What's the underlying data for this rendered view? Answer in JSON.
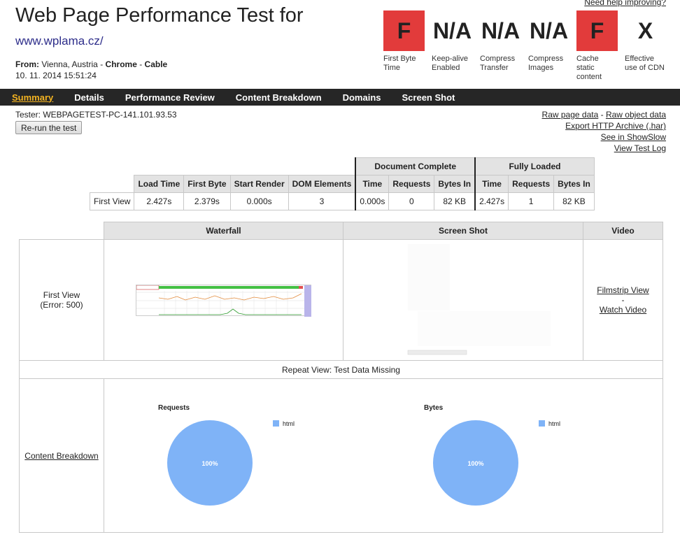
{
  "header": {
    "help_link": "Need help improving?",
    "title": "Web Page Performance Test for",
    "url": "www.wplama.cz/",
    "from_label": "From:",
    "from_location": "Vienna, Austria",
    "sep1": " - ",
    "browser": "Chrome",
    "sep2": " - ",
    "connection": "Cable",
    "date": "10. 11. 2014 15:51:24"
  },
  "grades": [
    {
      "value": "F",
      "label": "First Byte Time",
      "status": "fail"
    },
    {
      "value": "N/A",
      "label": "Keep-alive Enabled",
      "status": "na"
    },
    {
      "value": "N/A",
      "label": "Compress Transfer",
      "status": "na"
    },
    {
      "value": "N/A",
      "label": "Compress Images",
      "status": "na"
    },
    {
      "value": "F",
      "label": "Cache static content",
      "status": "fail"
    },
    {
      "value": "X",
      "label": "Effective use of CDN",
      "status": "na"
    }
  ],
  "nav": {
    "items": [
      "Summary",
      "Details",
      "Performance Review",
      "Content Breakdown",
      "Domains",
      "Screen Shot"
    ],
    "active": "Summary"
  },
  "tester": "Tester: WEBPAGETEST-PC-141.101.93.53",
  "rerun_label": "Re-run the test",
  "links": {
    "raw_page": "Raw page data",
    "dash": " - ",
    "raw_object": "Raw object data",
    "har": "Export HTTP Archive (.har)",
    "showslow": "See in ShowSlow",
    "test_log": "View Test Log"
  },
  "results": {
    "group_doc": "Document Complete",
    "group_full": "Fully Loaded",
    "headers": [
      "Load Time",
      "First Byte",
      "Start Render",
      "DOM Elements",
      "Time",
      "Requests",
      "Bytes In",
      "Time",
      "Requests",
      "Bytes In"
    ],
    "row_label": "First View",
    "row": [
      "2.427s",
      "2.379s",
      "0.000s",
      "3",
      "0.000s",
      "0",
      "82 KB",
      "2.427s",
      "1",
      "82 KB"
    ]
  },
  "detail": {
    "col_waterfall": "Waterfall",
    "col_screenshot": "Screen Shot",
    "col_video": "Video",
    "first_view": "First View",
    "first_view_error": "(Error: 500)",
    "filmstrip": "Filmstrip View",
    "dash": "-",
    "watch_video": "Watch Video",
    "repeat_missing": "Repeat View: Test Data Missing",
    "content_breakdown": "Content Breakdown"
  },
  "colors": {
    "fail": "#e23b3b",
    "nav_bg": "#262626",
    "nav_active": "#f3b321",
    "pie": "#7fb3f7"
  },
  "chart_data": [
    {
      "type": "pie",
      "title": "Requests",
      "categories": [
        "html"
      ],
      "values": [
        100
      ],
      "slice_labels": [
        "100%"
      ],
      "legend": "right"
    },
    {
      "type": "pie",
      "title": "Bytes",
      "categories": [
        "html"
      ],
      "values": [
        100
      ],
      "slice_labels": [
        "100%"
      ],
      "legend": "right"
    }
  ]
}
